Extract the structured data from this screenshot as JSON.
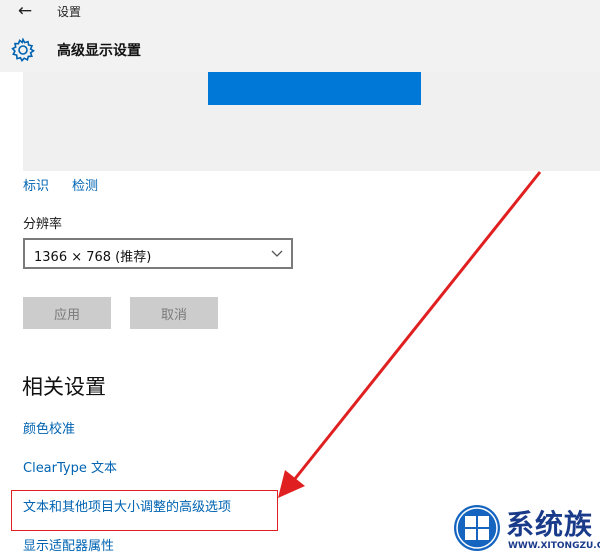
{
  "titlebar": {
    "back_icon": "←",
    "app_title": "设置"
  },
  "header": {
    "page_title": "高级显示设置",
    "icon": "gear-icon"
  },
  "preview": {
    "accent_color": "#0078d7"
  },
  "display_links": {
    "identify": "标识",
    "detect": "检测"
  },
  "resolution": {
    "label": "分辨率",
    "selected": "1366 × 768 (推荐)"
  },
  "buttons": {
    "apply": "应用",
    "cancel": "取消"
  },
  "related": {
    "title": "相关设置",
    "items": [
      "颜色校准",
      "ClearType 文本",
      "文本和其他项目大小调整的高级选项",
      "显示适配器属性"
    ]
  },
  "annotation": {
    "color": "#e02020"
  },
  "watermark": {
    "text": "系统族",
    "url": "WWW.XITONGZU.COM"
  }
}
